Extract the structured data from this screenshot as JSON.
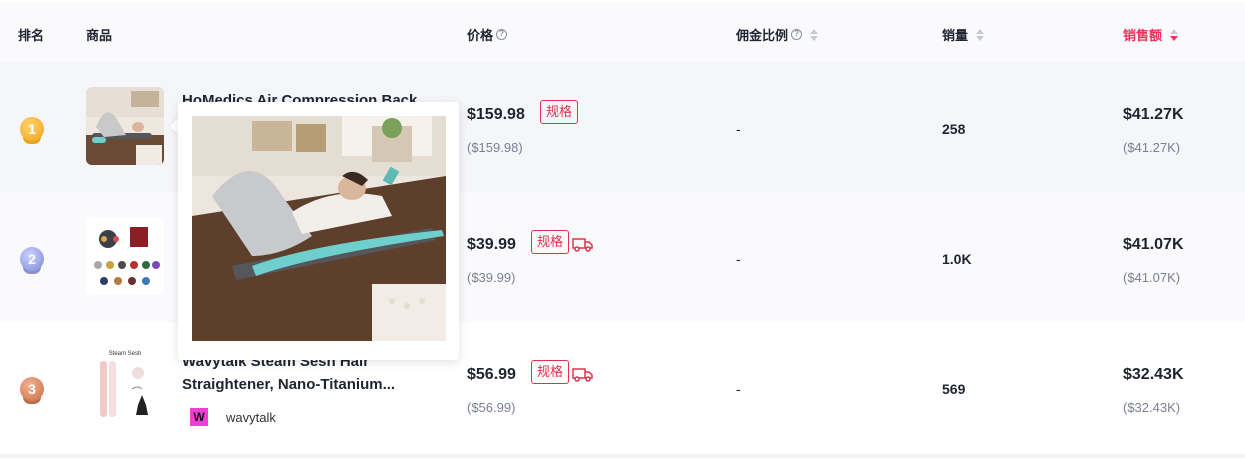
{
  "columns": {
    "rank": "排名",
    "product": "商品",
    "price": "价格",
    "commission": "佣金比例",
    "volume": "销量",
    "revenue": "销售额"
  },
  "rows": [
    {
      "rank": "1",
      "name": "HoMedics Air Compression Back",
      "price": "$159.98",
      "price_sub": "($159.98)",
      "spec_tag": "规格",
      "commission": "-",
      "volume": "258",
      "revenue": "$41.27K",
      "revenue_sub": "($41.27K)"
    },
    {
      "rank": "2",
      "price": "$39.99",
      "price_sub": "($39.99)",
      "spec_tag": "规格",
      "commission": "-",
      "volume": "1.0K",
      "revenue": "$41.07K",
      "revenue_sub": "($41.07K)"
    },
    {
      "rank": "3",
      "name_line1": "Wavytalk Steam Sesh Hair",
      "name_line2": "Straightener, Nano-Titanium...",
      "brand": "wavytalk",
      "brand_logo": "W",
      "thumb_caption": "Steam Sesh",
      "price": "$56.99",
      "price_sub": "($56.99)",
      "spec_tag": "规格",
      "commission": "-",
      "volume": "569",
      "revenue": "$32.43K",
      "revenue_sub": "($32.43K)"
    }
  ],
  "colors": {
    "accent": "#f0325a",
    "tag": "#e0324a",
    "muted": "#7a8091"
  }
}
